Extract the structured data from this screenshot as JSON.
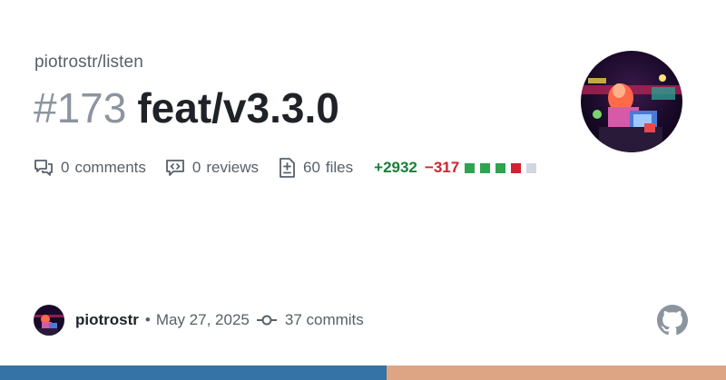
{
  "repo": "piotrostr/listen",
  "pr": {
    "number": "#173",
    "title": "feat/v3.3.0"
  },
  "stats": {
    "comments": {
      "value": "0",
      "label": "comments",
      "icon": "comment-discussion-icon"
    },
    "reviews": {
      "value": "0",
      "label": "reviews",
      "icon": "code-review-icon"
    },
    "files": {
      "value": "60",
      "label": "files",
      "icon": "file-diff-icon"
    },
    "additions": "+2932",
    "deletions": "−317",
    "diff_squares": [
      "added",
      "added",
      "added",
      "removed",
      "neutral"
    ]
  },
  "colors": {
    "added": "#2da44e",
    "removed": "#cf222e",
    "neutral": "#d0d7de",
    "lang_primary": "#3572a5",
    "lang_secondary": "#dea584"
  },
  "footer": {
    "author": "piotrostr",
    "separator": "•",
    "date": "May 27, 2025",
    "commits": "37 commits",
    "commit_icon": "git-commit-icon",
    "brand_icon": "github-mark-icon"
  }
}
